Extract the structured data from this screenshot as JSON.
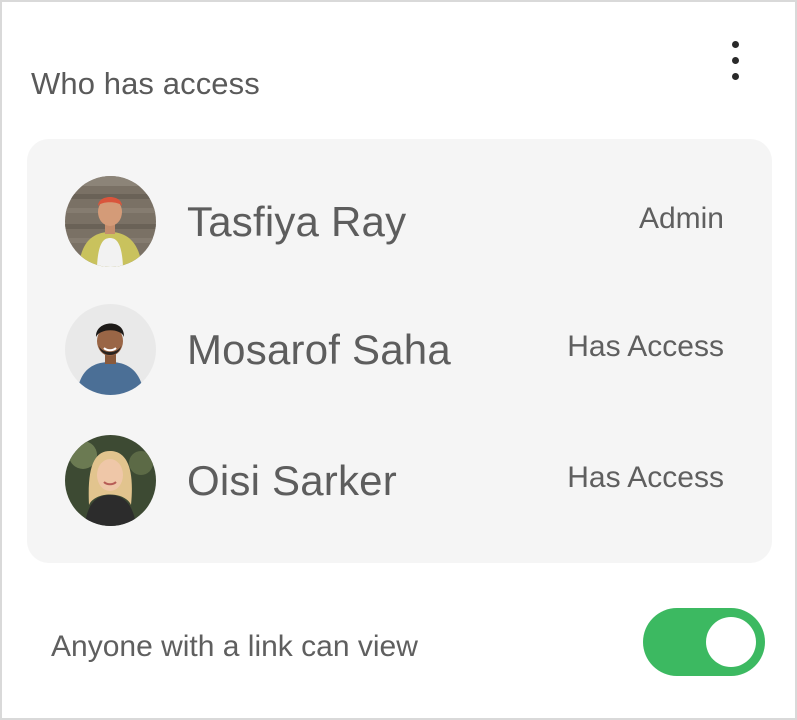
{
  "header": {
    "title": "Who has access",
    "menu_icon": "more-vertical-icon"
  },
  "people": [
    {
      "name": "Tasfiya Ray",
      "access": "Admin"
    },
    {
      "name": "Mosarof Saha",
      "access": "Has Access"
    },
    {
      "name": "Oisi Sarker",
      "access": "Has Access"
    }
  ],
  "link_sharing": {
    "label": "Anyone with a link can view",
    "enabled": true
  },
  "colors": {
    "toggle_on": "#3cb961",
    "panel_background": "#f5f5f5",
    "card_border": "#d9d9d9"
  }
}
